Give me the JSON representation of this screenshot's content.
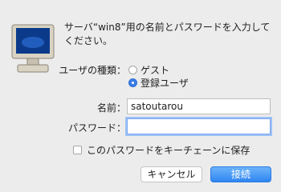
{
  "dialog": {
    "message": "サーバ“win8”用の名前とパスワードを入力してください。",
    "user_type_label": "ユーザの種類：",
    "radio_guest": "ゲスト",
    "radio_registered": "登録ユーザ",
    "selected_user_type": "登録ユーザ",
    "name_label": "名前：",
    "name_value": "satoutarou",
    "password_label": "パスワード：",
    "password_value": "",
    "keychain_label": "このパスワードをキーチェーンに保存",
    "keychain_checked": false,
    "cancel_label": "キャンセル",
    "connect_label": "接続"
  },
  "icons": {
    "server": "monitor-icon"
  },
  "colors": {
    "accent": "#3a7ee8",
    "background": "#ececec"
  }
}
